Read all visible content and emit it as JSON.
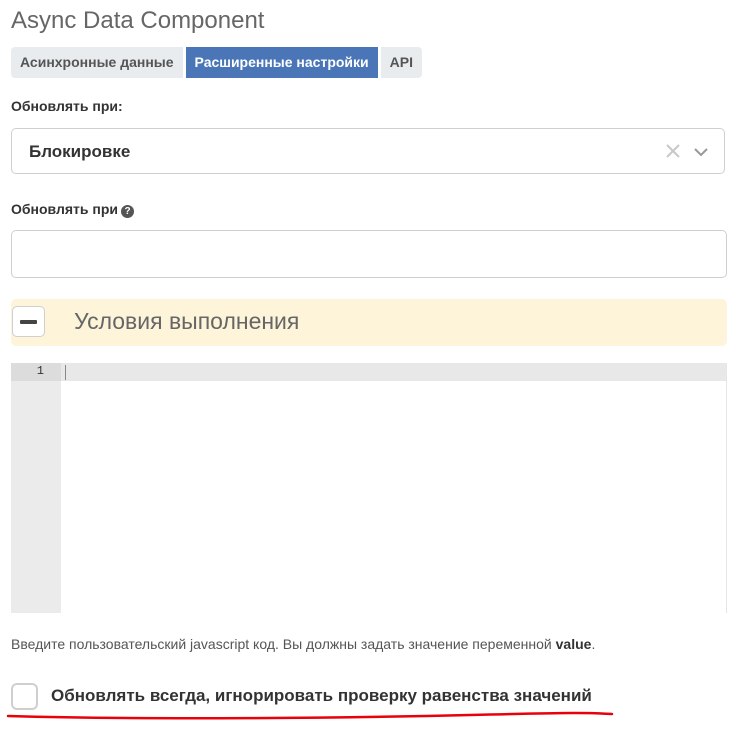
{
  "page": {
    "title": "Async Data Component"
  },
  "tabs": [
    {
      "label": "Асинхронные данные",
      "active": false
    },
    {
      "label": "Расширенные настройки",
      "active": true
    },
    {
      "label": "API",
      "active": false
    }
  ],
  "update_on": {
    "label": "Обновлять при:",
    "selected_value": "Блокировке",
    "clear_icon": "close-icon",
    "arrow_icon": "chevron-down-icon"
  },
  "update_on_input": {
    "label": "Обновлять при",
    "help_icon": "question-circle-icon",
    "help_glyph": "?",
    "value": "",
    "placeholder": ""
  },
  "conditions_panel": {
    "title": "Условия выполнения",
    "toggle_icon": "minus-icon",
    "background_color": "#fdf4d9"
  },
  "code_editor": {
    "line_numbers": [
      "1"
    ],
    "content": ""
  },
  "hint": {
    "text": "Введите пользовательский javascript код. Вы должны задать значение переменной ",
    "emphasis": "value",
    "suffix": "."
  },
  "always_update_checkbox": {
    "label": "Обновлять всегда, игнорировать проверку равенства значений",
    "checked": false,
    "annotation_color": "#e8000b"
  },
  "colors": {
    "accent": "#4a76b7",
    "tab_inactive": "#e9ecef",
    "border": "#cfcfcf"
  }
}
